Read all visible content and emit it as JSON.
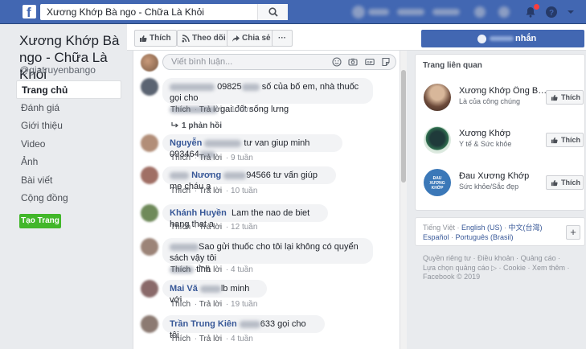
{
  "header": {
    "search_query": "Xương Khớp Bà ngo - Chữa Là Khỏi",
    "logo": "f"
  },
  "sidebar": {
    "page_name": "Xương Khớp Bà ngo - Chữa Là Khỏi",
    "handle": "@giatruyenbango",
    "items": [
      {
        "label": "Trang chủ",
        "active": true
      },
      {
        "label": "Đánh giá"
      },
      {
        "label": "Giới thiệu"
      },
      {
        "label": "Video"
      },
      {
        "label": "Ảnh"
      },
      {
        "label": "Bài viết"
      },
      {
        "label": "Cộng đồng"
      }
    ],
    "create_page_label": "Tạo Trang"
  },
  "actions": {
    "like": "Thích",
    "follow": "Theo dõi",
    "share": "Chia sẻ",
    "more": "···",
    "message": "nhắn"
  },
  "composer": {
    "placeholder": "Viết bình luận..."
  },
  "comments": [
    {
      "author": "",
      "line1_text": "09825",
      "line1_rest": "số của bố em, nhà thuốc gọi cho",
      "line2_rest": "gai đốt sống lưng",
      "like": "Thích",
      "reply": "Trả lời",
      "time": "1 năm",
      "replies": "1 phản hồi",
      "avatar_color": "#5b6472"
    },
    {
      "author": "Nguyễn",
      "text": "tư van giup minh 093464",
      "like": "Thích",
      "reply": "Trả lời",
      "time": "9 tuần",
      "avatar_color": "#b28e78"
    },
    {
      "author": "Nương",
      "text": "94566 tư vấn giúp mẹ cháu ạ",
      "like": "Thích",
      "reply": "Trả lời",
      "time": "10 tuần",
      "avatar_color": "#a06f65"
    },
    {
      "author": "Khánh Huyền",
      "text": "Lam the nao de biet hang that a",
      "like": "Thích",
      "reply": "Trả lời",
      "time": "12 tuần",
      "avatar_color": "#6f8a5a"
    },
    {
      "author": "",
      "line1_rest": "Sao gửi thuốc cho tôi lại không có quyển sách vậy tôi",
      "line2_rest": "tỉnh",
      "like": "Thích",
      "reply": "Trả lời",
      "time": "4 tuần",
      "avatar_color": "#9c8478"
    },
    {
      "author": "Mai Vă",
      "text": "lb minh với",
      "like": "Thích",
      "reply": "Trả lời",
      "time": "19 tuần",
      "avatar_color": "#8a6a6a"
    },
    {
      "author": "Trần Trung Kiên",
      "text": "633 gọi cho tôi",
      "like": "Thích",
      "reply": "Trả lời",
      "time": "4 tuần",
      "avatar_color": "#8c7a72"
    }
  ],
  "related": {
    "title": "Trang liên quan",
    "pages": [
      {
        "name": "Xương Khớp Ông Bả...",
        "category": "Là của công chúng",
        "like": "Thích"
      },
      {
        "name": "Xương Khớp",
        "category": "Y tế & Sức khỏe",
        "like": "Thích"
      },
      {
        "name": "Đau Xương Khớp",
        "category": "Sức khỏe/Sắc đẹp",
        "like": "Thích",
        "logo_text": "ĐAU XƯƠNG KHỚP"
      }
    ]
  },
  "languages": {
    "line1": [
      "Tiếng Việt",
      "English (US)",
      "中文(台灣)"
    ],
    "line2": [
      "Español",
      "Português (Brasil)"
    ],
    "plus": "+"
  },
  "footer": {
    "line1": "Quyền riêng tư · Điều khoản · Quảng cáo ·",
    "line2": "Lựa chọn quảng cáo ▷ · Cookie · Xem thêm ·",
    "line3": "Facebook © 2019"
  },
  "colors": {
    "brand": "#4267b2",
    "link": "#385898",
    "green": "#42b72a"
  }
}
